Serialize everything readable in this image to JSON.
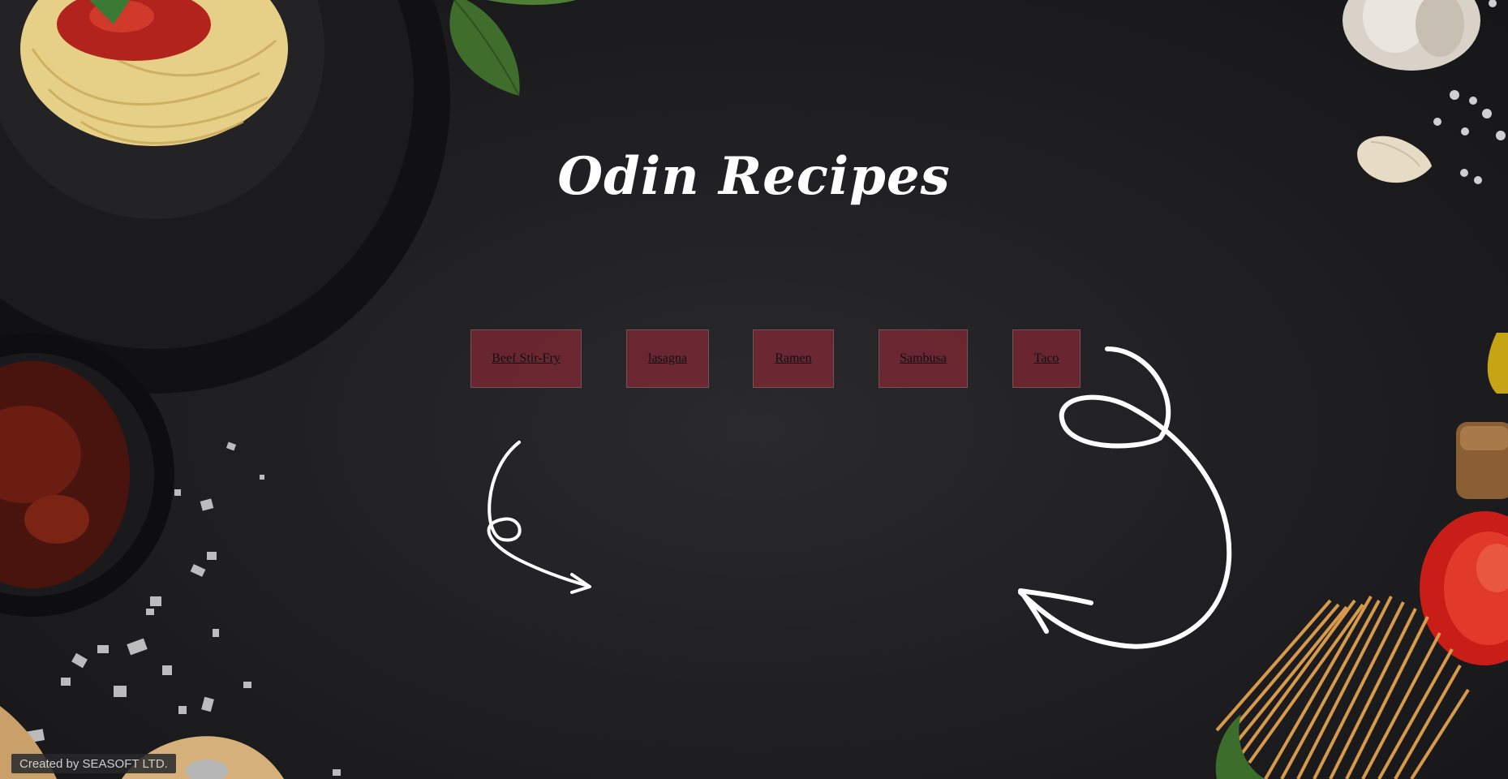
{
  "page": {
    "title": "Odin Recipes"
  },
  "nav": {
    "items": [
      {
        "label": "Beef Stir-Fry"
      },
      {
        "label": "lasagna"
      },
      {
        "label": "Ramen"
      },
      {
        "label": "Sambusa"
      },
      {
        "label": "Taco"
      }
    ]
  },
  "footer": {
    "credit": "Created by SEASOFT LTD."
  },
  "colors": {
    "background": "#1f1f21",
    "button_fill": "#8a2a36",
    "title_text": "#ffffff"
  }
}
